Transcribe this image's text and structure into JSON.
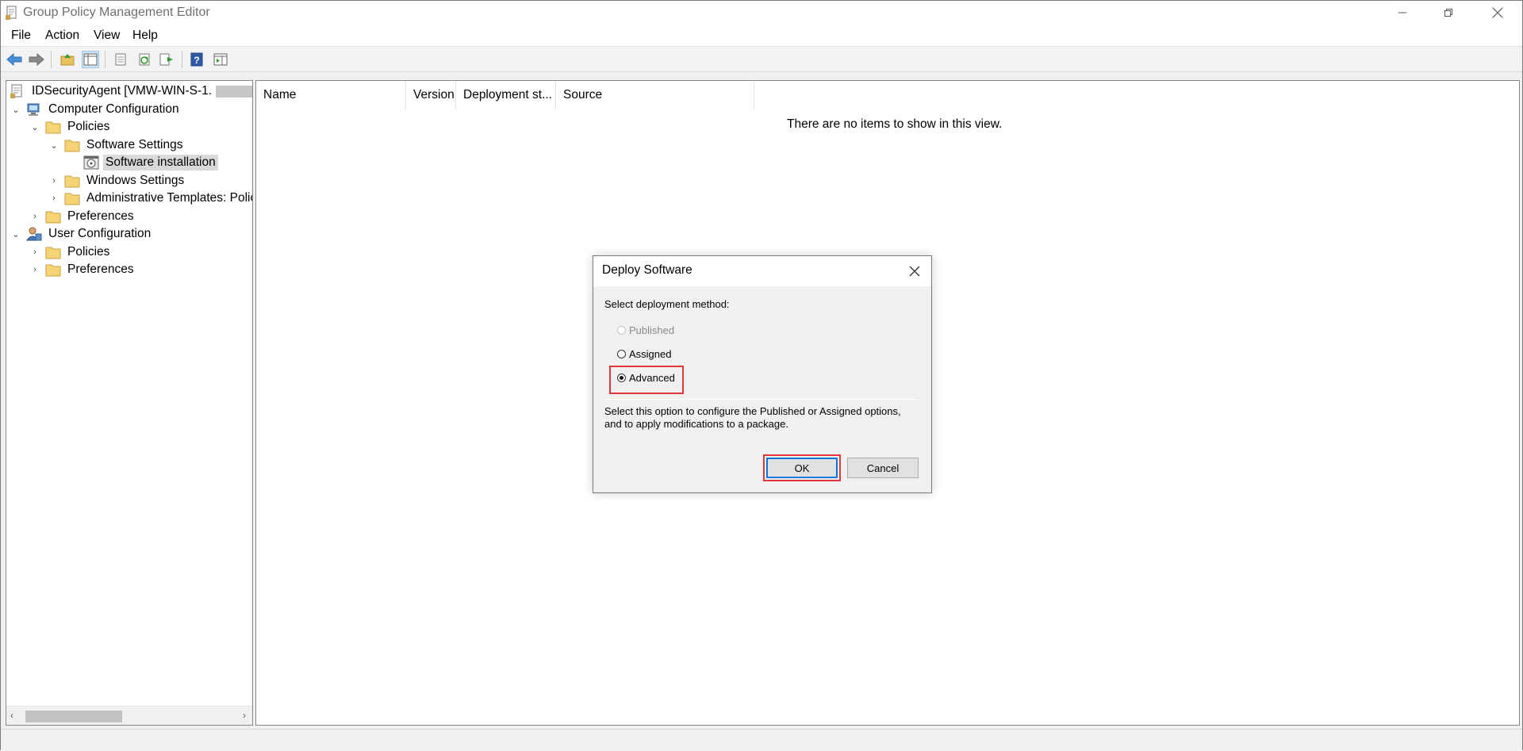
{
  "window": {
    "title": "Group Policy Management Editor"
  },
  "menu": [
    "File",
    "Action",
    "View",
    "Help"
  ],
  "toolbar": {
    "icons": [
      "back-icon",
      "forward-icon",
      "up-folder-icon",
      "show-hide-tree-icon",
      "properties-icon",
      "refresh-icon",
      "export-list-icon",
      "help-icon",
      "show-action-pane-icon"
    ]
  },
  "tree": {
    "root": "IDSecurityAgent [VMW-WIN-S-1.",
    "computer_configuration": "Computer Configuration",
    "cc_policies": "Policies",
    "software_settings": "Software Settings",
    "software_installation": "Software installation",
    "windows_settings": "Windows Settings",
    "admin_templates": "Administrative Templates: Policy",
    "cc_preferences": "Preferences",
    "user_configuration": "User Configuration",
    "uc_policies": "Policies",
    "uc_preferences": "Preferences"
  },
  "list": {
    "columns": [
      "Name",
      "Version",
      "Deployment st...",
      "Source"
    ],
    "empty_message": "There are no items to show in this view."
  },
  "dialog": {
    "title": "Deploy Software",
    "prompt": "Select deployment method:",
    "options": [
      {
        "label": "Published",
        "selected": false,
        "disabled": true
      },
      {
        "label": "Assigned",
        "selected": false,
        "disabled": false
      },
      {
        "label": "Advanced",
        "selected": true,
        "disabled": false
      }
    ],
    "description_line1": "Select this option to configure the Published or Assigned options,",
    "description_line2": "and to apply modifications to a package.",
    "ok_label": "OK",
    "cancel_label": "Cancel",
    "highlight_color": "#e0383a"
  }
}
